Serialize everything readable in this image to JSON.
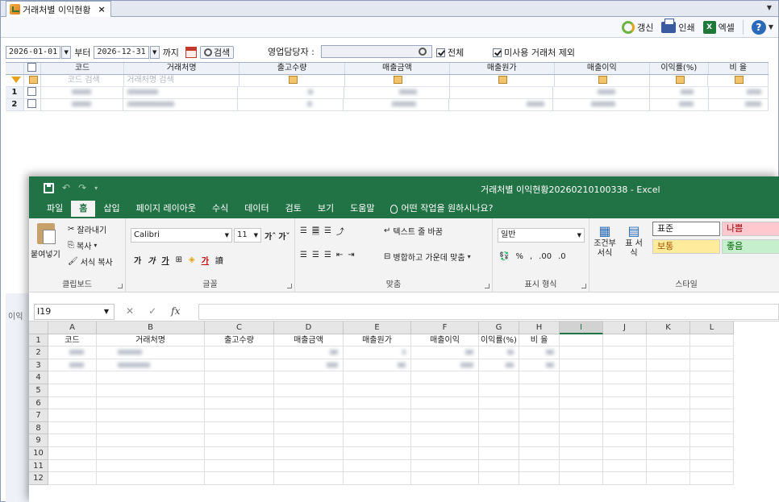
{
  "erp": {
    "tab_title": "거래처별 이익현황",
    "tab_close": "×",
    "toolbar": {
      "refresh_label": "갱신",
      "print_label": "인쇄",
      "excel_label": "엑셀",
      "excel_icon_text": "X"
    },
    "filter": {
      "date_from": "2026-01-01",
      "from_label": "부터",
      "date_to": "2026-12-31",
      "to_label": "까지",
      "search_label": "검색",
      "sales_rep_label": "영업담당자 :",
      "sales_rep_value": "",
      "all_label": "전체",
      "all_checked": true,
      "exclude_label": "미사용 거래처 제외",
      "exclude_checked": true
    },
    "grid": {
      "headers": [
        "코드",
        "거래처명",
        "출고수량",
        "매출금액",
        "매출원가",
        "매출이익",
        "이익률(%)",
        "비 율"
      ],
      "filter_placeholders": [
        "코드 검색",
        "거래처명 검색"
      ],
      "rows": [
        {
          "num": "1"
        },
        {
          "num": "2"
        }
      ]
    },
    "side_label": "이익"
  },
  "excel": {
    "title": "거래처별 이익현황20260210100338  -  Excel",
    "tabs": [
      "파일",
      "홈",
      "삽입",
      "페이지 레이아웃",
      "수식",
      "데이터",
      "검토",
      "보기",
      "도움말"
    ],
    "tell_me": "어떤 작업을 원하시나요?",
    "clipboard": {
      "paste": "붙여넣기",
      "cut": "잘라내기",
      "copy": "복사",
      "format_painter": "서식 복사",
      "group": "클립보드"
    },
    "font": {
      "name": "Calibri",
      "size": "11",
      "group": "글꼴"
    },
    "alignment": {
      "wrap": "텍스트 줄 바꿈",
      "merge": "병합하고 가운데 맞춤",
      "group": "맞춤"
    },
    "number": {
      "format": "일반",
      "group": "표시 형식"
    },
    "styles": {
      "conditional": "조건부 서식",
      "table": "표 서식",
      "normal": "표준",
      "bad": "나쁨",
      "neutral": "보통",
      "good": "좋음",
      "group": "스타일"
    },
    "name_box": "I19",
    "fx": "fx",
    "columns": [
      "A",
      "B",
      "C",
      "D",
      "E",
      "F",
      "G",
      "H",
      "I",
      "J",
      "K",
      "L"
    ],
    "row1": [
      "코드",
      "거래처명",
      "출고수량",
      "매출금액",
      "매출원가",
      "매출이익",
      "이익률(%)",
      "비 율"
    ],
    "row_numbers": [
      "1",
      "2",
      "3",
      "4",
      "5",
      "6",
      "7",
      "8",
      "9",
      "10",
      "11",
      "12"
    ]
  },
  "colors": {
    "excel_green": "#217346",
    "bad_bg": "#ffc7ce",
    "bad_fg": "#9c0006",
    "neutral_bg": "#ffeb9c",
    "neutral_fg": "#9c5700",
    "good_bg": "#c6efce",
    "good_fg": "#006100"
  }
}
